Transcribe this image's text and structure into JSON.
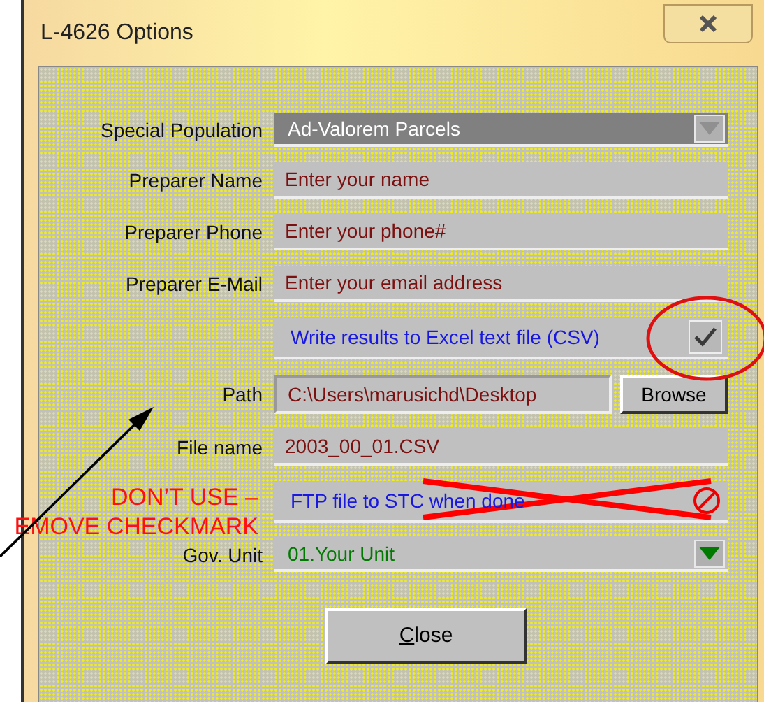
{
  "window": {
    "title": "L-4626 Options"
  },
  "rows": [
    {
      "kind": "select",
      "label": "Special Population",
      "value": "Ad-Valorem Parcels",
      "disabled": true
    },
    {
      "kind": "text",
      "label": "Preparer Name",
      "placeholder": "Enter your name"
    },
    {
      "kind": "text",
      "label": "Preparer Phone",
      "placeholder": "Enter your phone#"
    },
    {
      "kind": "text",
      "label": "Preparer E-Mail",
      "placeholder": "Enter your email address"
    },
    {
      "kind": "checkbox",
      "text": "Write results to Excel text file (CSV)",
      "checked": true,
      "circled": true,
      "crossed_out": false
    },
    {
      "kind": "path",
      "label": "Path",
      "value": "C:\\Users\\marusichd\\Desktop",
      "button": "Browse"
    },
    {
      "kind": "text",
      "label": "File name",
      "value": "2003_00_01.CSV"
    },
    {
      "kind": "checkbox",
      "text": "FTP file to STC when done",
      "circled": false,
      "crossed_out": true
    },
    {
      "kind": "select",
      "label": "Gov. Unit",
      "value": "01.Your Unit",
      "disabled": false
    }
  ],
  "annotation": {
    "lines": [
      "DON’T USE –",
      "EMOVE CHECKMARK"
    ]
  },
  "close_button": "Close"
}
